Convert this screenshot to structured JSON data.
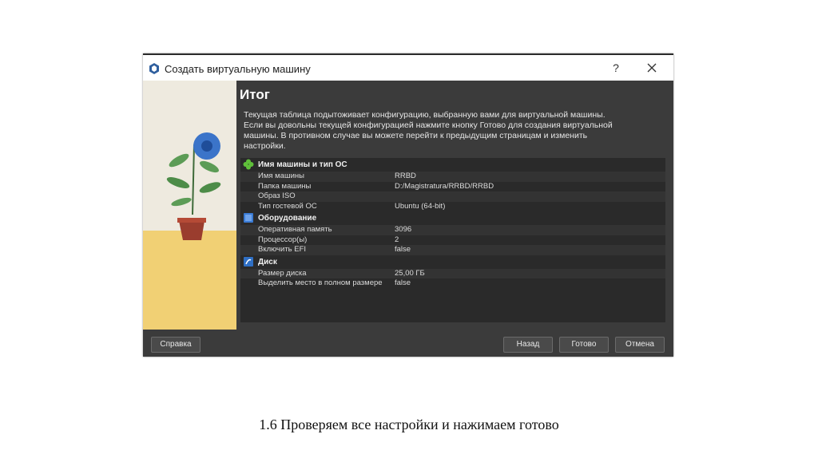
{
  "window": {
    "title": "Создать виртуальную машину",
    "help": "?",
    "close": "✕"
  },
  "page": {
    "heading": "Итог",
    "description": "Текущая таблица подытоживает конфигурацию, выбранную вами для виртуальной машины. Если вы довольны текущей конфигурацией нажмите кнопку Готово для создания виртуальной машины. В противном случае вы можете перейти к предыдущим страницам и изменить настройки."
  },
  "sections": [
    {
      "title": "Имя машины и тип ОС",
      "icon": "name-os-icon",
      "rows": [
        {
          "key": "Имя машины",
          "value": "RRBD"
        },
        {
          "key": "Папка машины",
          "value": "D:/Magistratura/RRBD/RRBD"
        },
        {
          "key": "Образ ISO",
          "value": ""
        },
        {
          "key": "Тип гостевой ОС",
          "value": "Ubuntu (64-bit)"
        }
      ]
    },
    {
      "title": "Оборудование",
      "icon": "hardware-icon",
      "rows": [
        {
          "key": "Оперативная память",
          "value": "3096"
        },
        {
          "key": "Процессор(ы)",
          "value": "2"
        },
        {
          "key": "Включить EFI",
          "value": "false"
        }
      ]
    },
    {
      "title": "Диск",
      "icon": "disk-icon",
      "rows": [
        {
          "key": "Размер диска",
          "value": "25,00 ГБ"
        },
        {
          "key": "Выделить место в полном размере",
          "value": "false"
        }
      ]
    }
  ],
  "buttons": {
    "help": "Справка",
    "back": "Назад",
    "finish": "Готово",
    "cancel": "Отмена"
  },
  "caption": "1.6 Проверяем все настройки и нажимаем готово",
  "colors": {
    "dialog_bg": "#3b3b3b",
    "table_bg": "#2a2a2a",
    "accent_green": "#5fbf3a",
    "accent_blue": "#3a7bd5"
  }
}
